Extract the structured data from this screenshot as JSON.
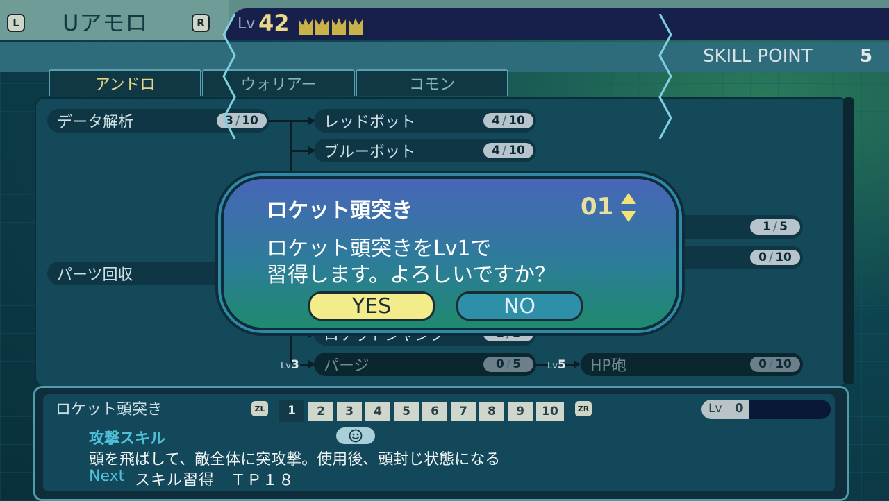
{
  "header": {
    "left_button": "L",
    "right_button": "R",
    "character_name": "Uアモロ",
    "level_label": "Lv",
    "level": "42",
    "skill_point_label": "SKILL POINT",
    "skill_point_value": "5"
  },
  "tabs": [
    {
      "label": "アンドロ",
      "active": true
    },
    {
      "label": "ウォリアー",
      "active": false
    },
    {
      "label": "コモン",
      "active": false
    }
  ],
  "skills": {
    "data_analysis": {
      "name": "データ解析",
      "cur": "3",
      "max": "10"
    },
    "red_bot": {
      "name": "レッドボット",
      "cur": "4",
      "max": "10"
    },
    "blue_bot": {
      "name": "ブルーボット",
      "cur": "4",
      "max": "10"
    },
    "parts_recovery": {
      "name": "パーツ回収"
    },
    "reflector": {
      "cur": "1",
      "max": "5"
    },
    "right_second": {
      "cur": "0",
      "max": "10"
    },
    "rocket_jump": {
      "name": "ロケットジャンプ",
      "cur": "1",
      "max": "5"
    },
    "purge": {
      "name": "パージ",
      "cur": "0",
      "max": "5",
      "req_label": "Lv",
      "req_level": "3"
    },
    "hp_cannon": {
      "name": "HP砲",
      "cur": "0",
      "max": "10",
      "req_label": "Lv",
      "req_level": "5"
    }
  },
  "dialog": {
    "title": "ロケット頭突き",
    "quantity": "01",
    "line1": "ロケット頭突きをLv1で",
    "line2": "習得します。よろしいですか？",
    "yes": "YES",
    "no": "NO"
  },
  "info": {
    "skill_name": "ロケット頭突き",
    "zl": "ZL",
    "zr": "ZR",
    "levels": [
      "1",
      "2",
      "3",
      "4",
      "5",
      "6",
      "7",
      "8",
      "9",
      "10"
    ],
    "selected_level": "1",
    "lv_label": "Lv",
    "lv_value": "0",
    "type": "攻撃スキル",
    "description": "頭を飛ばして、敵全体に突攻撃。使用後、頭封じ状態になる",
    "next_label": "Next",
    "next_text": "スキル習得　ＴＰ１８"
  },
  "colors": {
    "accent_yellow": "#f2ec8a",
    "level_gold": "#e9d98a",
    "skill_type_cyan": "#4fc0d8"
  }
}
